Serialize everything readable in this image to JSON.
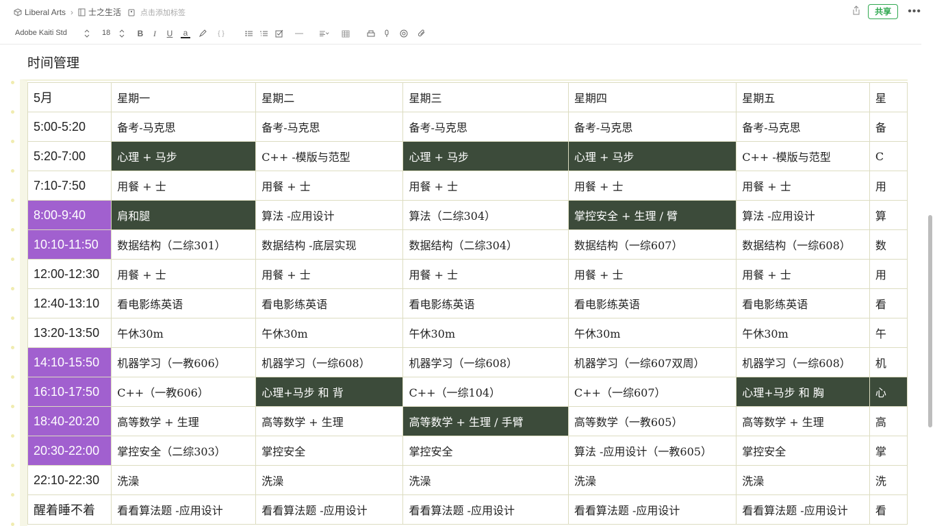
{
  "breadcrumb": {
    "notebook": "Liberal Arts",
    "note": "士之生活",
    "add_tag": "点击添加标签"
  },
  "header": {
    "share_label": "共享",
    "more_label": "•••"
  },
  "toolbar": {
    "font_family": "Adobe Kaiti Std",
    "font_size": "18",
    "bold": "B",
    "italic": "I",
    "underline": "U",
    "text_color": "a",
    "code": "{ }"
  },
  "document": {
    "title": "时间管理"
  },
  "table": {
    "columns": [
      "5月",
      "星期一",
      "星期二",
      "星期三",
      "星期四",
      "星期五",
      "星"
    ],
    "rows": [
      {
        "cells": [
          "5:00-5:20",
          "备考-马克思",
          "备考-马克思",
          "备考-马克思",
          "备考-马克思",
          "备考-马克思",
          "备"
        ],
        "style": [
          "",
          "",
          "",
          "",
          "",
          "",
          ""
        ]
      },
      {
        "cells": [
          "5:20-7:00",
          "心理 + 马步",
          "C++ -模版与范型",
          "心理 + 马步",
          "心理 + 马步",
          "C++ -模版与范型",
          "C"
        ],
        "style": [
          "",
          "dark",
          "",
          "dark",
          "dark",
          "",
          ""
        ]
      },
      {
        "cells": [
          "7:10-7:50",
          "用餐 + 士",
          "用餐 + 士",
          "用餐 + 士",
          "用餐 + 士",
          "用餐 + 士",
          "用"
        ],
        "style": [
          "",
          "",
          "",
          "",
          "",
          "",
          ""
        ]
      },
      {
        "cells": [
          "8:00-9:40",
          "肩和腿",
          "算法 -应用设计",
          "算法（二综304）",
          "掌控安全 + 生理 / 臂",
          "算法 -应用设计",
          "算"
        ],
        "style": [
          "purple",
          "dark",
          "",
          "",
          "dark",
          "",
          ""
        ]
      },
      {
        "cells": [
          "10:10-11:50",
          "数据结构（二综301）",
          "数据结构 -底层实现",
          "数据结构（二综304）",
          "数据结构（一综607）",
          "数据结构（一综608）",
          "数"
        ],
        "style": [
          "purple",
          "",
          "",
          "",
          "",
          "",
          ""
        ]
      },
      {
        "cells": [
          "12:00-12:30",
          "用餐 + 士",
          "用餐 + 士",
          "用餐 + 士",
          "用餐 + 士",
          "用餐 + 士",
          "用"
        ],
        "style": [
          "",
          "",
          "",
          "",
          "",
          "",
          ""
        ]
      },
      {
        "cells": [
          "12:40-13:10",
          "看电影练英语",
          "看电影练英语",
          "看电影练英语",
          "看电影练英语",
          "看电影练英语",
          "看"
        ],
        "style": [
          "",
          "",
          "",
          "",
          "",
          "",
          ""
        ]
      },
      {
        "cells": [
          "13:20-13:50",
          "午休30m",
          "午休30m",
          "午休30m",
          "午休30m",
          "午休30m",
          "午"
        ],
        "style": [
          "",
          "",
          "",
          "",
          "",
          "",
          ""
        ]
      },
      {
        "cells": [
          "14:10-15:50",
          "机器学习（一教606）",
          "机器学习（一综608）",
          "机器学习（一综608）",
          "机器学习（一综607双周）",
          "机器学习（一综608）",
          "机"
        ],
        "style": [
          "purple",
          "",
          "",
          "",
          "",
          "",
          ""
        ]
      },
      {
        "cells": [
          "16:10-17:50",
          "C++（一教606）",
          "心理+马步 和 背",
          "C++（一综104）",
          "C++（一综607）",
          "心理+马步 和 胸",
          "心"
        ],
        "style": [
          "purple",
          "",
          "dark",
          "",
          "",
          "dark",
          "dark"
        ]
      },
      {
        "cells": [
          "18:40-20:20",
          "高等数学 + 生理",
          "高等数学 + 生理",
          "高等数学 + 生理 / 手臂",
          "高等数学（一教605）",
          "高等数学 + 生理",
          "高"
        ],
        "style": [
          "purple",
          "",
          "",
          "dark",
          "",
          "",
          ""
        ]
      },
      {
        "cells": [
          "20:30-22:00",
          "掌控安全（二综303）",
          "掌控安全",
          "掌控安全",
          "算法 -应用设计（一教605）",
          "掌控安全",
          "掌"
        ],
        "style": [
          "purple",
          "",
          "",
          "",
          "",
          "",
          ""
        ]
      },
      {
        "cells": [
          "22:10-22:30",
          "洗澡",
          "洗澡",
          "洗澡",
          "洗澡",
          "洗澡",
          "洗"
        ],
        "style": [
          "",
          "",
          "",
          "",
          "",
          "",
          ""
        ]
      },
      {
        "cells": [
          "醒着睡不着",
          "看看算法题 -应用设计",
          "看看算法题 -应用设计",
          "看看算法题 -应用设计",
          "看看算法题 -应用设计",
          "看看算法题 -应用设计",
          "看"
        ],
        "style": [
          "",
          "",
          "",
          "",
          "",
          "",
          ""
        ]
      }
    ]
  },
  "colors": {
    "dark_cell": "#3c4b3a",
    "purple_cell": "#a160cf",
    "share_green": "#2fa84f",
    "border": "#dcdcc0"
  }
}
